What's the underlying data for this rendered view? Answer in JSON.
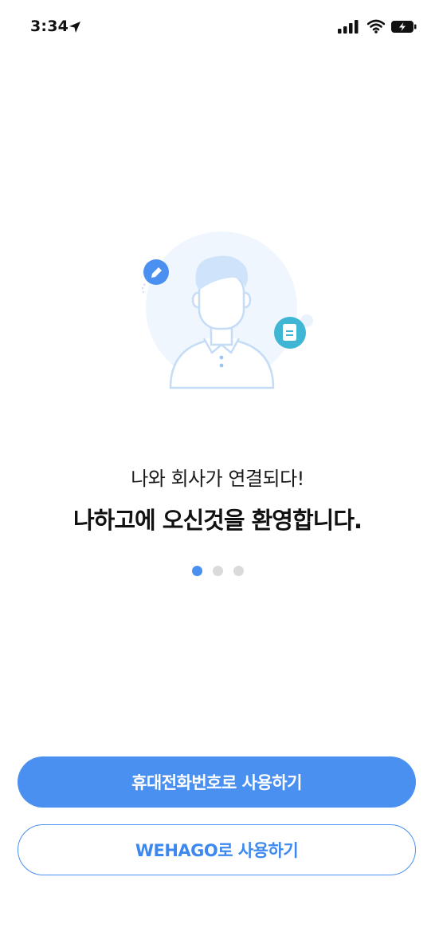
{
  "status_bar": {
    "time": "3:34",
    "icons": [
      "location-arrow-icon",
      "signal-icon",
      "wifi-icon",
      "battery-charging-icon"
    ]
  },
  "illustration": {
    "name": "user-profile-illustration",
    "icons": [
      "pencil-icon",
      "document-icon"
    ],
    "colors": {
      "accent": "#4a90f0",
      "teal": "#3fb6d3",
      "light": "#cfe3fb"
    }
  },
  "welcome": {
    "subtitle": "나와 회사가 연결되다!",
    "title": "나하고에 오신것을 환영합니다."
  },
  "pagination": {
    "count": 3,
    "active_index": 0
  },
  "buttons": {
    "phone_login": "휴대전화번호로 사용하기",
    "wehago_login": "WEHAGO로 사용하기"
  },
  "colors": {
    "primary": "#4a90f0",
    "inactive_dot": "#dadada"
  }
}
